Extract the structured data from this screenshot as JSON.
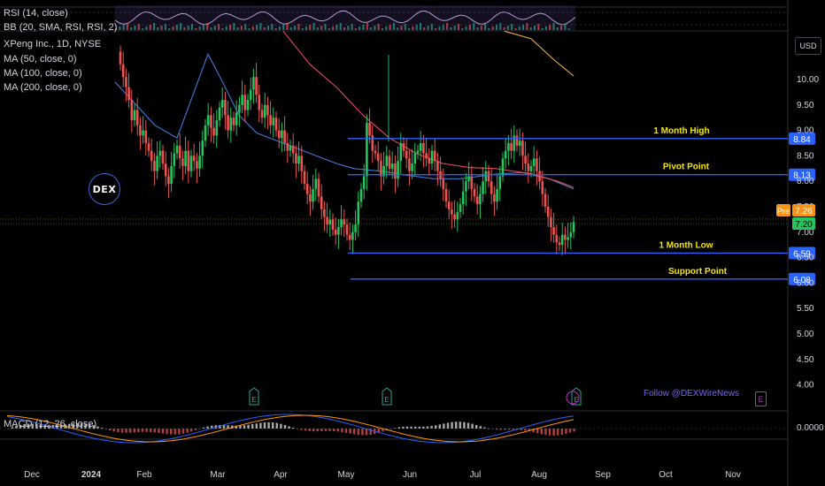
{
  "header": {
    "symbol": "XPeng Inc., 1D, NYSE",
    "rsi_label": "RSI (14, close)",
    "bb_label": "BB (20, SMA, RSI, RSI, 2)",
    "ma50_label": "MA (50, close, 0)",
    "ma100_label": "MA (100, close, 0)",
    "ma200_label": "MA (200, close, 0)",
    "macd_label": "MACD (12, 26, close)"
  },
  "currency_button": "USD",
  "logo_text": "DEX",
  "watermark": "Follow @DEXWireNews",
  "colors": {
    "background": "#000000",
    "up": "#26a69a",
    "up_bright": "#22c55e",
    "down": "#ef5350",
    "level_line": "#2962ff",
    "level_label": "#f5e60a",
    "ma50": "#3d7bd9",
    "ma100": "#e64a5a",
    "ma200": "#f3a93c",
    "price_tag_green": "#22c55e",
    "premarket_tag": "#f7931a"
  },
  "price_tags": {
    "premarket_label": "Pre",
    "premarket_price": "7.26",
    "last_price": "7.20"
  },
  "chart_data": {
    "type": "candlestick",
    "title": "XPeng Inc., 1D, NYSE",
    "y_axis_ticks": [
      "10.00",
      "9.50",
      "9.00",
      "8.50",
      "8.00",
      "7.50",
      "7.00",
      "6.50",
      "6.00",
      "5.50",
      "5.00",
      "4.50",
      "4.00"
    ],
    "x_axis_ticks": [
      "Dec",
      "2024",
      "Feb",
      "Mar",
      "Apr",
      "May",
      "Jun",
      "Jul",
      "Aug",
      "Sep",
      "Oct",
      "Nov"
    ],
    "levels": [
      {
        "label": "1 Month High",
        "value": "8.84"
      },
      {
        "label": "Pivot Point",
        "value": "8.13"
      },
      {
        "label": "1 Month Low",
        "value": "6.59"
      },
      {
        "label": "Support Point",
        "value": "6.08"
      }
    ],
    "closes": [
      10.3,
      10.05,
      9.85,
      9.6,
      9.2,
      9.4,
      9.1,
      8.9,
      9.0,
      8.75,
      8.6,
      8.4,
      8.2,
      8.5,
      8.6,
      8.35,
      8.1,
      7.95,
      8.3,
      8.55,
      8.7,
      8.45,
      8.3,
      8.6,
      8.2,
      8.5,
      8.4,
      8.25,
      8.5,
      8.8,
      9.1,
      9.3,
      9.05,
      8.9,
      9.2,
      9.45,
      9.6,
      9.3,
      9.0,
      9.25,
      9.1,
      9.35,
      9.5,
      9.7,
      9.4,
      9.6,
      9.8,
      10.05,
      9.7,
      9.4,
      9.25,
      9.5,
      9.3,
      9.1,
      9.25,
      9.0,
      8.85,
      9.0,
      8.75,
      8.6,
      8.7,
      8.55,
      8.35,
      8.5,
      8.2,
      7.95,
      7.75,
      7.6,
      7.85,
      8.05,
      7.7,
      7.45,
      7.3,
      7.15,
      7.25,
      7.05,
      6.95,
      7.1,
      7.25,
      7.15,
      6.95,
      6.85,
      7.0,
      7.15,
      7.6,
      7.85,
      8.1,
      9.15,
      8.9,
      8.6,
      8.55,
      8.4,
      8.1,
      8.3,
      8.5,
      8.25,
      8.35,
      8.05,
      8.4,
      8.75,
      8.6,
      8.45,
      8.2,
      8.35,
      8.55,
      8.6,
      8.75,
      8.55,
      8.45,
      8.35,
      8.6,
      8.4,
      8.2,
      8.05,
      7.85,
      7.6,
      7.45,
      7.35,
      7.25,
      7.4,
      7.55,
      7.8,
      8.0,
      8.1,
      7.85,
      7.7,
      7.55,
      7.75,
      8.0,
      8.2,
      8.0,
      7.75,
      7.6,
      7.85,
      8.1,
      8.45,
      8.6,
      8.75,
      8.6,
      8.9,
      8.7,
      8.8,
      8.5,
      8.35,
      8.2,
      8.3,
      8.45,
      8.2,
      8.0,
      7.75,
      7.5,
      7.3,
      7.1,
      6.95,
      6.8,
      6.75,
      6.95,
      6.85,
      6.9,
      7.0,
      7.2
    ],
    "ma50": [
      [
        130,
        9.95
      ],
      [
        175,
        9.1
      ],
      [
        200,
        8.85
      ],
      [
        235,
        10.5
      ],
      [
        250,
        10.0
      ],
      [
        270,
        9.3
      ],
      [
        290,
        8.95
      ],
      [
        320,
        8.75
      ],
      [
        350,
        8.55
      ],
      [
        380,
        8.35
      ],
      [
        400,
        8.25
      ],
      [
        430,
        8.2
      ],
      [
        460,
        8.12
      ],
      [
        490,
        8.05
      ],
      [
        520,
        8.05
      ],
      [
        560,
        8.14
      ],
      [
        590,
        8.17
      ],
      [
        620,
        8.05
      ],
      [
        648,
        7.85
      ]
    ],
    "ma100": [
      [
        320,
        10.95
      ],
      [
        350,
        10.3
      ],
      [
        380,
        9.85
      ],
      [
        410,
        9.3
      ],
      [
        440,
        8.85
      ],
      [
        470,
        8.55
      ],
      [
        500,
        8.35
      ],
      [
        530,
        8.27
      ],
      [
        560,
        8.25
      ],
      [
        600,
        8.15
      ],
      [
        630,
        8.0
      ],
      [
        648,
        7.88
      ]
    ],
    "ma200": [
      [
        570,
        10.95
      ],
      [
        600,
        10.8
      ],
      [
        625,
        10.4
      ],
      [
        648,
        10.07
      ]
    ]
  }
}
